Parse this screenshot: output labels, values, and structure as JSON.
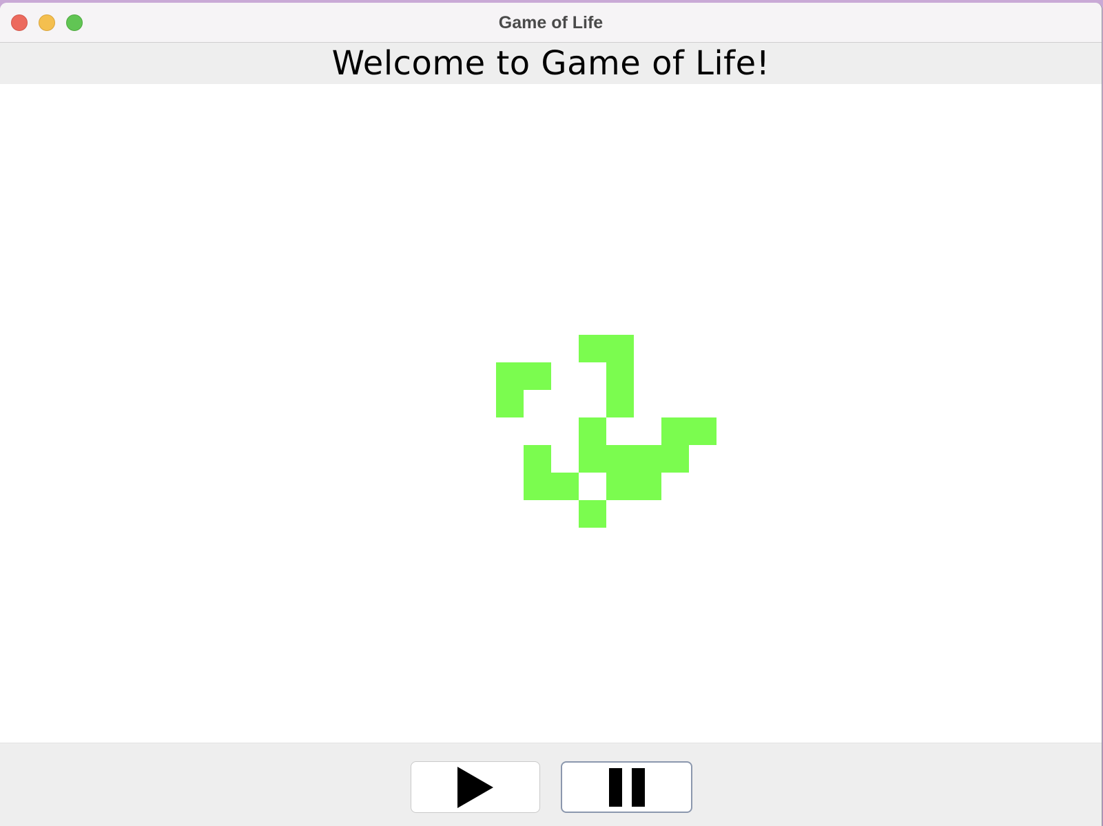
{
  "window": {
    "title": "Game of Life"
  },
  "header": {
    "welcome_text": "Welcome to Game of Life!"
  },
  "board": {
    "live_cell_color": "#7bfc4f",
    "background_color": "#ffffff",
    "live_cells": [
      [
        3,
        0
      ],
      [
        4,
        0
      ],
      [
        0,
        1
      ],
      [
        1,
        1
      ],
      [
        4,
        1
      ],
      [
        0,
        2
      ],
      [
        4,
        2
      ],
      [
        3,
        3
      ],
      [
        6,
        3
      ],
      [
        7,
        3
      ],
      [
        1,
        4
      ],
      [
        3,
        4
      ],
      [
        4,
        4
      ],
      [
        5,
        4
      ],
      [
        6,
        4
      ],
      [
        1,
        5
      ],
      [
        2,
        5
      ],
      [
        4,
        5
      ],
      [
        5,
        5
      ],
      [
        3,
        6
      ]
    ]
  },
  "controls": {
    "play_icon": "play-icon",
    "pause_icon": "pause-icon"
  }
}
